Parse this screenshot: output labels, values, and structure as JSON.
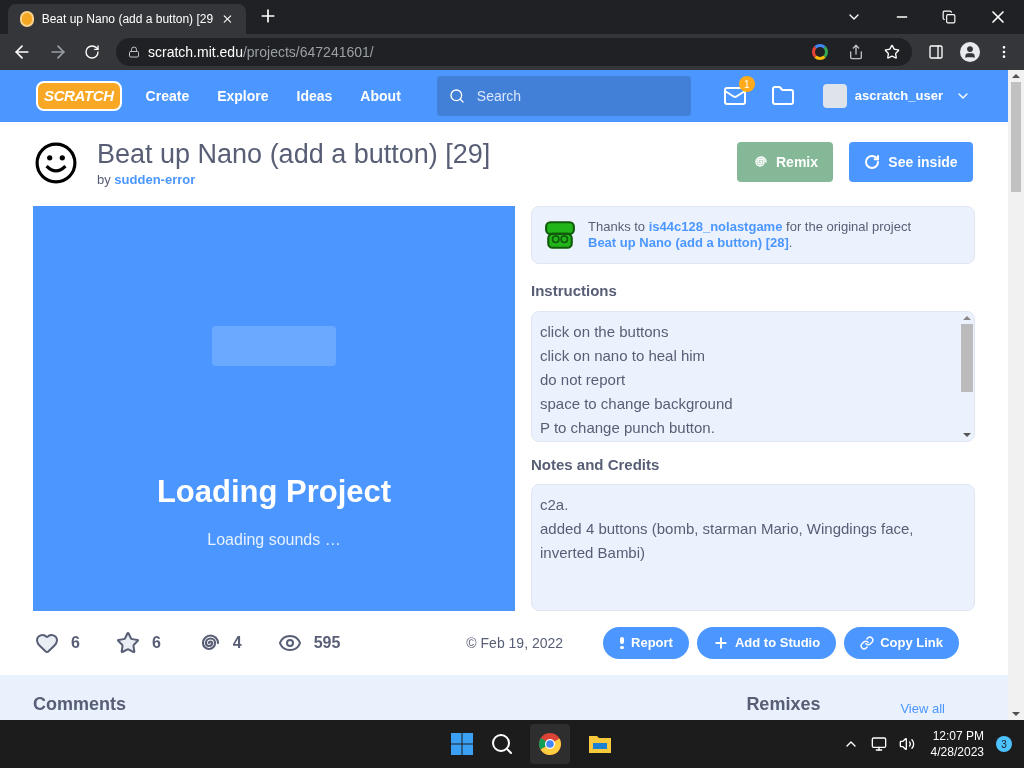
{
  "browser": {
    "tab_title": "Beat up Nano (add a button) [29",
    "url_host": "scratch.mit.edu",
    "url_path": "/projects/647241601/"
  },
  "nav": {
    "logo": "SCRATCH",
    "links": [
      "Create",
      "Explore",
      "Ideas",
      "About"
    ],
    "search_placeholder": "Search",
    "messages_count": "1",
    "username": "ascratch_user"
  },
  "project": {
    "title": "Beat up Nano (add a button) [29]",
    "by": "by",
    "author": "sudden-error",
    "remix_label": "Remix",
    "see_inside_label": "See inside"
  },
  "player": {
    "status": "Loading Project",
    "detail": "Loading sounds …"
  },
  "remix_note": {
    "prefix": "Thanks to",
    "user": "is44c128_nolastgame",
    "middle": "for the original project",
    "parent": "Beat up Nano (add a button) [28]",
    "suffix": "."
  },
  "instructions": {
    "heading": "Instructions",
    "lines": [
      "click on the buttons",
      "click on nano to heal him",
      "do not report",
      "space to change background",
      "P to change punch button."
    ]
  },
  "notes": {
    "heading": "Notes and Credits",
    "lines": [
      "c2a.",
      "added 4 buttons (bomb, starman Mario, Wingdings face, inverted Bambi)"
    ]
  },
  "stats": [
    {
      "kind": "love",
      "count": "6"
    },
    {
      "kind": "favorite",
      "count": "6"
    },
    {
      "kind": "remix",
      "count": "4"
    },
    {
      "kind": "views",
      "count": "595"
    }
  ],
  "date": "© Feb 19, 2022",
  "actions": [
    {
      "kind": "report",
      "label": "Report"
    },
    {
      "kind": "studio",
      "label": "Add to Studio"
    },
    {
      "kind": "link",
      "label": "Copy Link"
    }
  ],
  "lower": {
    "comments": "Comments",
    "remixes": "Remixes",
    "view_all": "View all"
  },
  "taskbar": {
    "time": "12:07 PM",
    "date": "4/28/2023",
    "notifications": "3"
  }
}
